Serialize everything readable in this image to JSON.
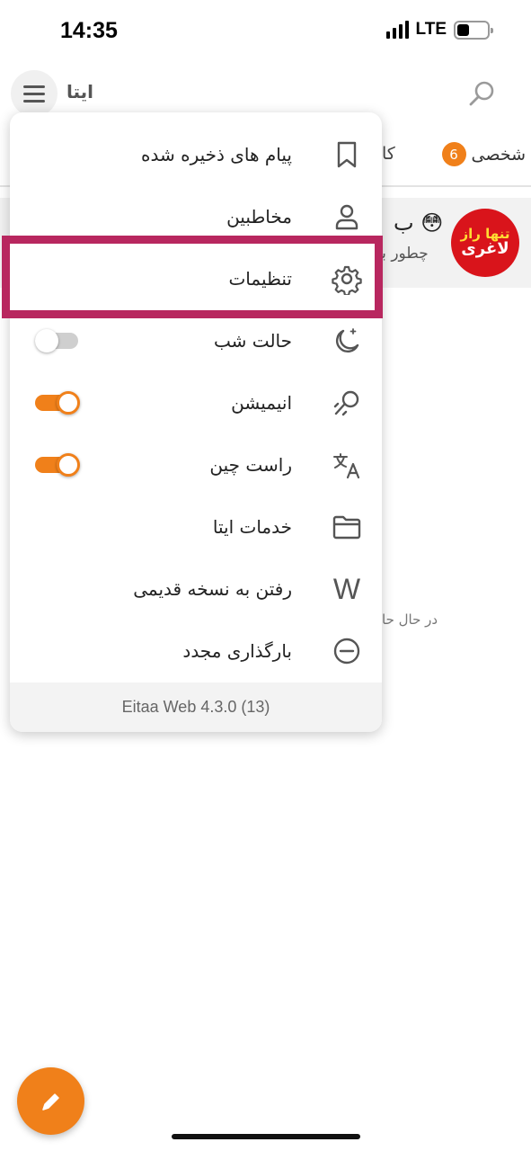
{
  "status_bar": {
    "time": "14:35",
    "network": "LTE"
  },
  "header": {
    "title": "ایتا",
    "menu_icon": "hamburger-icon",
    "search_icon": "search-icon"
  },
  "tabs": {
    "personal_label": "شخصی",
    "personal_badge": "6",
    "other_label_partial": "کا"
  },
  "chat_preview": {
    "avatar_text_top": "تنها راز",
    "avatar_text_bottom": "لاغری",
    "emoji": "😳",
    "title_partial": "ب",
    "message_partial": "چطور با"
  },
  "loading_text_partial": "در حال حا",
  "menu": {
    "items": [
      {
        "label": "پیام های ذخیره شده",
        "icon": "bookmark-icon"
      },
      {
        "label": "مخاطبین",
        "icon": "user-icon"
      },
      {
        "label": "تنظیمات",
        "icon": "gear-icon"
      },
      {
        "label": "حالت شب",
        "icon": "moon-icon",
        "toggle": false
      },
      {
        "label": "انیمیشن",
        "icon": "animation-icon",
        "toggle": true
      },
      {
        "label": "راست چین",
        "icon": "translate-icon",
        "toggle": true
      },
      {
        "label": "خدمات ایتا",
        "icon": "folder-icon"
      },
      {
        "label": "رفتن به نسخه قدیمی",
        "icon": "w-icon",
        "icon_glyph": "W"
      },
      {
        "label": "بارگذاری مجدد",
        "icon": "minus-circle-icon"
      }
    ],
    "footer": "Eitaa Web 4.3.0 (13)"
  },
  "colors": {
    "accent": "#f0801a",
    "highlight": "#b8275f",
    "avatar_red": "#d9141b"
  },
  "fab": {
    "icon": "pencil-icon"
  }
}
